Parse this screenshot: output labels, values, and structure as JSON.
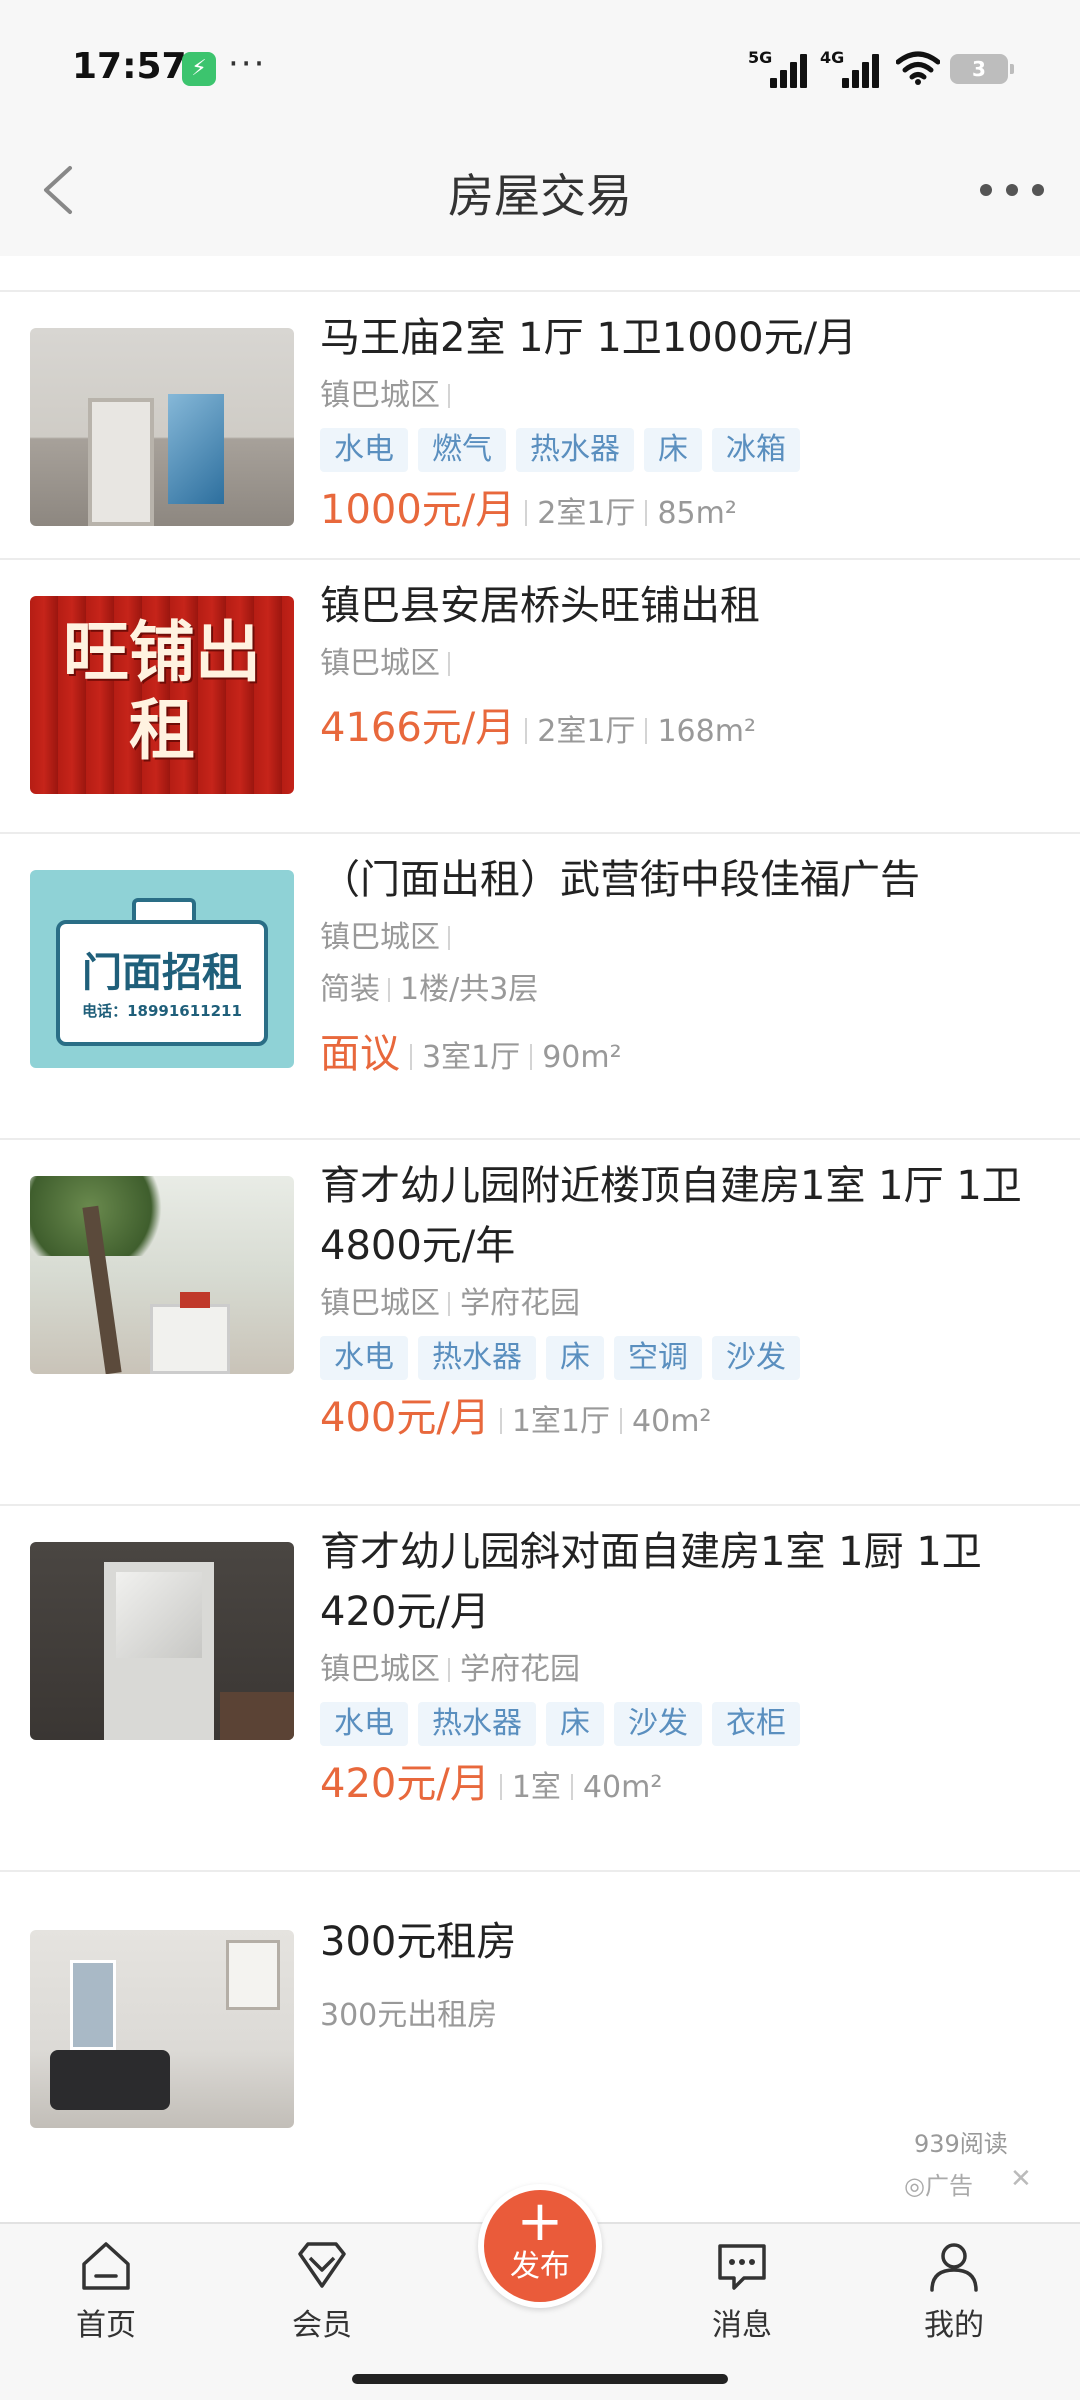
{
  "status_bar": {
    "time": "17:57",
    "network1": "5G",
    "network2": "4G",
    "battery": "3"
  },
  "nav": {
    "title": "房屋交易"
  },
  "listings": [
    {
      "title": "马王庙2室 1厅 1卫1000元/月",
      "district": "镇巴城区",
      "community": "",
      "tags": [
        "水电",
        "燃气",
        "热水器",
        "床",
        "冰箱"
      ],
      "price": "1000元/月",
      "rooms": "2室1厅",
      "area": "85m²"
    },
    {
      "title": "镇巴县安居桥头旺铺出租",
      "district": "镇巴城区",
      "community": "",
      "price": "4166元/月",
      "rooms": "2室1厅",
      "area": "168m²",
      "thumb_text": "旺铺出租"
    },
    {
      "title": "（门面出租）武营街中段佳福广告",
      "district": "镇巴城区",
      "community": "",
      "decoration": "简装",
      "floor": "1楼/共3层",
      "price": "面议",
      "rooms": "3室1厅",
      "area": "90m²",
      "thumb_big": "门面招租",
      "thumb_small": "电话：18991611211"
    },
    {
      "title": "育才幼儿园附近楼顶自建房1室 1厅 1卫4800元/年",
      "district": "镇巴城区",
      "community": "学府花园",
      "tags": [
        "水电",
        "热水器",
        "床",
        "空调",
        "沙发"
      ],
      "price": "400元/月",
      "rooms": "1室1厅",
      "area": "40m²"
    },
    {
      "title": "育才幼儿园斜对面自建房1室 1厨 1卫420元/月",
      "district": "镇巴城区",
      "community": "学府花园",
      "tags": [
        "水电",
        "热水器",
        "床",
        "沙发",
        "衣柜"
      ],
      "price": "420元/月",
      "rooms": "1室",
      "area": "40m²"
    },
    {
      "title": "300元租房",
      "subtitle": "300元出租房",
      "reads": "939阅读",
      "ad_label": "广告"
    }
  ],
  "tabbar": {
    "home": "首页",
    "member": "会员",
    "publish": "发布",
    "messages": "消息",
    "mine": "我的"
  },
  "colors": {
    "price": "#e8683c",
    "tag_bg": "#eef5fb",
    "tag_text": "#5a8fbf",
    "publish": "#ea5b3a"
  }
}
